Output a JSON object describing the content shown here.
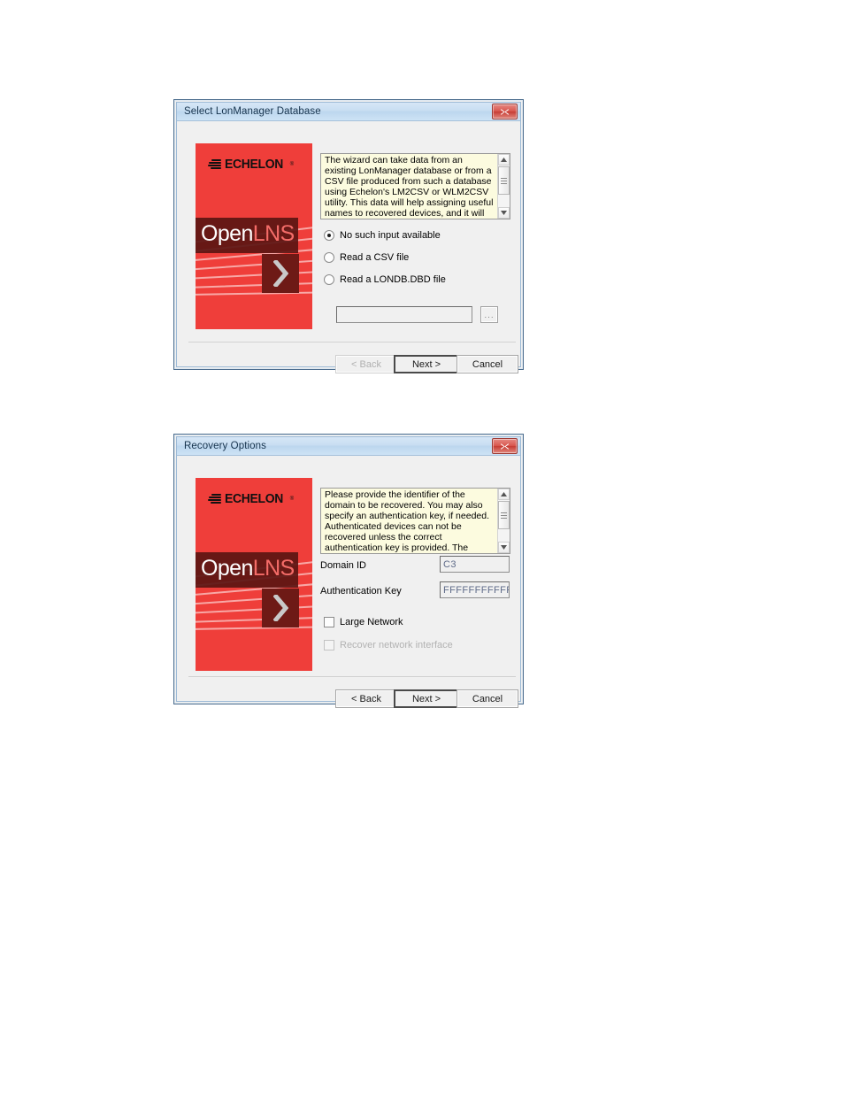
{
  "colors": {
    "brand_red": "#ef3e3a",
    "brand_dark_red": "#5b1512",
    "chevron_box": "#6e1a16",
    "accent_lns": "#f46c68",
    "titlebar_blue": "#c8def2",
    "info_bg": "#fcfbdf",
    "dialog_bg": "#f0f0f0"
  },
  "brand": {
    "company": "ECHELON",
    "trademark": "®",
    "product_prefix": "Open",
    "product_suffix": "LNS",
    "chevron_icon": "chevron-right-icon"
  },
  "dialog1": {
    "title": "Select LonManager Database",
    "close_label": "✕",
    "info_text": "The wizard can take data from an existing LonManager database or from a CSV file produced from such a database using Echelon's LM2CSV or WLM2CSV utility. This data will help assigning useful names to recovered devices, and it will assist the wizard in structuring the",
    "options": [
      {
        "label": "No such input available",
        "checked": true
      },
      {
        "label": "Read a CSV file",
        "checked": false
      },
      {
        "label": "Read a LONDB.DBD file",
        "checked": false
      }
    ],
    "path_field": {
      "value": "",
      "placeholder": ""
    },
    "browse_label": "...",
    "buttons": [
      {
        "label": "< Back",
        "state": "disabled"
      },
      {
        "label": "Next >",
        "state": "default"
      },
      {
        "label": "Cancel",
        "state": "normal"
      }
    ]
  },
  "dialog2": {
    "title": "Recovery Options",
    "close_label": "✕",
    "info_text": "Please provide the identifier of the domain to be recovered. You may also specify an authentication key, if needed. Authenticated devices can not be recovered unless the correct authentication key is provided. The option to recover large networks should be considered if",
    "fields": [
      {
        "label": "Domain ID",
        "value": "C3"
      },
      {
        "label": "Authentication Key",
        "value": "FFFFFFFFFFFF"
      }
    ],
    "checkboxes": [
      {
        "label": "Large Network",
        "checked": false,
        "state": "normal"
      },
      {
        "label": "Recover network interface",
        "checked": false,
        "state": "disabled"
      }
    ],
    "buttons": [
      {
        "label": "< Back",
        "state": "normal"
      },
      {
        "label": "Next >",
        "state": "default"
      },
      {
        "label": "Cancel",
        "state": "normal"
      }
    ]
  }
}
